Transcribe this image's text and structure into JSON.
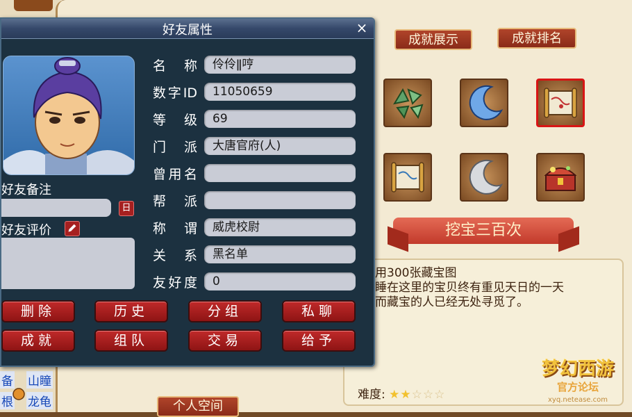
{
  "achievement_panel": {
    "show_button": "成就展示",
    "rank_button": "成就排名",
    "slots": [
      {
        "icon": "jade-shards-icon"
      },
      {
        "icon": "blue-crescent-moon-icon"
      },
      {
        "icon": "treasure-map-scroll-icon",
        "selected": true
      },
      {
        "icon": "treasure-map-scroll-icon"
      },
      {
        "icon": "silver-crescent-moon-icon"
      },
      {
        "icon": "treasure-chest-icon"
      }
    ],
    "achievement_title": "挖宝三百次",
    "description_lines": [
      "用300张藏宝图",
      "睡在这里的宝贝终有重见天日的一天",
      "而藏宝的人已经无处寻觅了。"
    ],
    "difficulty_label": "难度:",
    "difficulty_stars": 2,
    "difficulty_max": 5,
    "personal_space_button": "个人空间"
  },
  "side": {
    "label_a": "备",
    "label_b": "山瞳",
    "label_c": "根",
    "label_d": "龙龟"
  },
  "logo": {
    "title": "梦幻西游",
    "subtitle": "官方论坛",
    "url": "xyq.netease.com"
  },
  "dialog": {
    "title": "好友属性",
    "close": "×",
    "fields": [
      {
        "label": "名 称",
        "value": "伶伶ǁ哼"
      },
      {
        "label": "数字ID",
        "value": "11050659"
      },
      {
        "label": "等 级",
        "value": "69"
      },
      {
        "label": "门 派",
        "value": "大唐官府(人)"
      },
      {
        "label": "曾用名",
        "value": ""
      },
      {
        "label": "帮 派",
        "value": ""
      },
      {
        "label": "称 谓",
        "value": "威虎校尉"
      },
      {
        "label": "关 系",
        "value": "黑名单"
      },
      {
        "label": "友好度",
        "value": "0"
      }
    ],
    "note_label": "好友备注",
    "note_value": "",
    "note_button": "日",
    "eval_label": "好友评价",
    "eval_value": "",
    "actions": [
      "删除",
      "历史",
      "分组",
      "私聊",
      "成就",
      "组队",
      "交易",
      "给予"
    ]
  },
  "colors": {
    "accent_red": "#a62020",
    "dialog_bg": "#1c3140",
    "field_bg": "#c9ccd6",
    "star": "#f2c12e"
  }
}
